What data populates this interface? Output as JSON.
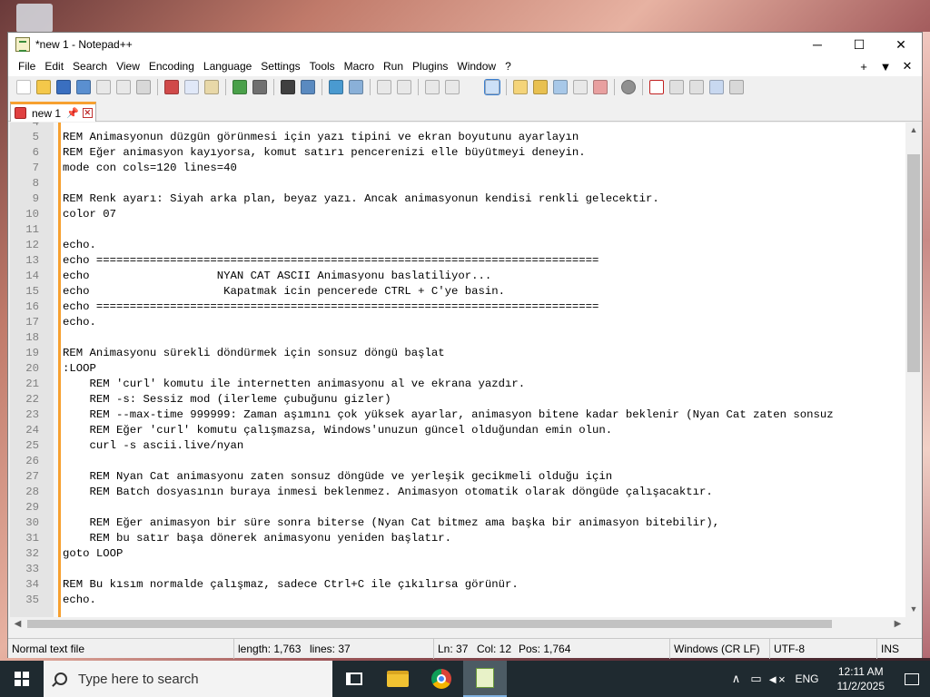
{
  "window": {
    "title": "*new 1 - Notepad++",
    "minimize": "─",
    "maximize": "☐",
    "close": "✕"
  },
  "menu": {
    "items": [
      "File",
      "Edit",
      "Search",
      "View",
      "Encoding",
      "Language",
      "Settings",
      "Tools",
      "Macro",
      "Run",
      "Plugins",
      "Window",
      "?"
    ],
    "right": [
      "+",
      "▼",
      "✕"
    ]
  },
  "tab": {
    "label": "new 1",
    "pin": "📌",
    "close": "✕"
  },
  "editor": {
    "first_line_number": "4",
    "lines": [
      {
        "n": "5",
        "t": "REM Animasyonun düzgün görünmesi için yazı tipini ve ekran boyutunu ayarlayın"
      },
      {
        "n": "6",
        "t": "REM Eğer animasyon kayıyorsa, komut satırı pencerenizi elle büyütmeyi deneyin."
      },
      {
        "n": "7",
        "t": "mode con cols=120 lines=40"
      },
      {
        "n": "8",
        "t": ""
      },
      {
        "n": "9",
        "t": "REM Renk ayarı: Siyah arka plan, beyaz yazı. Ancak animasyonun kendisi renkli gelecektir."
      },
      {
        "n": "10",
        "t": "color 07"
      },
      {
        "n": "11",
        "t": ""
      },
      {
        "n": "12",
        "t": "echo."
      },
      {
        "n": "13",
        "t": "echo ==========================================================================="
      },
      {
        "n": "14",
        "t": "echo                   NYAN CAT ASCII Animasyonu baslatiliyor..."
      },
      {
        "n": "15",
        "t": "echo                    Kapatmak icin pencerede CTRL + C'ye basin."
      },
      {
        "n": "16",
        "t": "echo ==========================================================================="
      },
      {
        "n": "17",
        "t": "echo."
      },
      {
        "n": "18",
        "t": ""
      },
      {
        "n": "19",
        "t": "REM Animasyonu sürekli döndürmek için sonsuz döngü başlat"
      },
      {
        "n": "20",
        "t": ":LOOP"
      },
      {
        "n": "21",
        "t": "    REM 'curl' komutu ile internetten animasyonu al ve ekrana yazdır."
      },
      {
        "n": "22",
        "t": "    REM -s: Sessiz mod (ilerleme çubuğunu gizler)"
      },
      {
        "n": "23",
        "t": "    REM --max-time 999999: Zaman aşımını çok yüksek ayarlar, animasyon bitene kadar beklenir (Nyan Cat zaten sonsuz"
      },
      {
        "n": "24",
        "t": "    REM Eğer 'curl' komutu çalışmazsa, Windows'unuzun güncel olduğundan emin olun."
      },
      {
        "n": "25",
        "t": "    curl -s ascii.live/nyan"
      },
      {
        "n": "26",
        "t": ""
      },
      {
        "n": "27",
        "t": "    REM Nyan Cat animasyonu zaten sonsuz döngüde ve yerleşik gecikmeli olduğu için"
      },
      {
        "n": "28",
        "t": "    REM Batch dosyasının buraya inmesi beklenmez. Animasyon otomatik olarak döngüde çalışacaktır."
      },
      {
        "n": "29",
        "t": ""
      },
      {
        "n": "30",
        "t": "    REM Eğer animasyon bir süre sonra biterse (Nyan Cat bitmez ama başka bir animasyon bitebilir),"
      },
      {
        "n": "31",
        "t": "    REM bu satır başa dönerek animasyonu yeniden başlatır."
      },
      {
        "n": "32",
        "t": "goto LOOP"
      },
      {
        "n": "33",
        "t": ""
      },
      {
        "n": "34",
        "t": "REM Bu kısım normalde çalışmaz, sadece Ctrl+C ile çıkılırsa görünür."
      },
      {
        "n": "35",
        "t": "echo."
      }
    ]
  },
  "status": {
    "type": "Normal text file",
    "length": "length: 1,763",
    "lines": "lines: 37",
    "ln": "Ln: 37",
    "col": "Col: 12",
    "pos": "Pos: 1,764",
    "eol": "Windows (CR LF)",
    "encoding": "UTF-8",
    "mode": "INS"
  },
  "taskbar": {
    "search_placeholder": "Type here to search",
    "language": "ENG",
    "time": "12:11 AM",
    "date": "11/2/2025"
  }
}
